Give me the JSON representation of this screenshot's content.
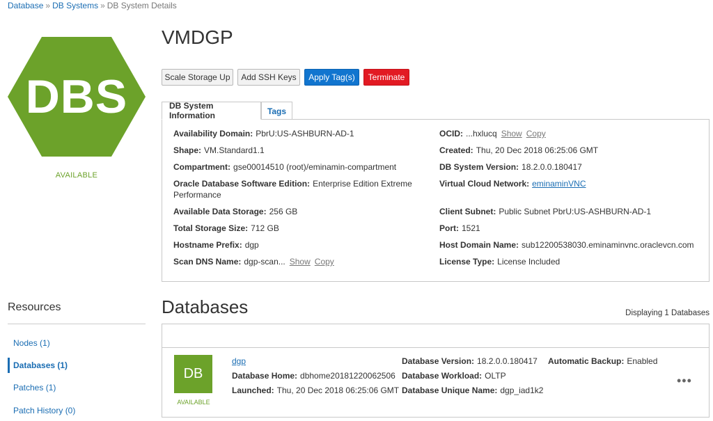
{
  "breadcrumb": {
    "items": [
      "Database",
      "DB Systems",
      "DB System Details"
    ],
    "separator": "»"
  },
  "logo": {
    "text": "DBS",
    "status": "AVAILABLE",
    "color": "#6ca22a",
    "icon": "hexagon-icon"
  },
  "title": "VMDGP",
  "actions": {
    "scale_storage": "Scale Storage Up",
    "add_ssh": "Add SSH Keys",
    "apply_tags": "Apply Tag(s)",
    "terminate": "Terminate"
  },
  "tabs": {
    "info": "DB System Information",
    "tags": "Tags"
  },
  "info": {
    "availability_domain": {
      "label": "Availability Domain:",
      "value": "PbrU:US-ASHBURN-AD-1"
    },
    "shape": {
      "label": "Shape:",
      "value": "VM.Standard1.1"
    },
    "compartment": {
      "label": "Compartment:",
      "value": "gse00014510 (root)/eminamin-compartment"
    },
    "edition": {
      "label": "Oracle Database Software Edition:",
      "value_line1": "Enterprise Edition Extreme",
      "value_line2": "Performance"
    },
    "available_storage": {
      "label": "Available Data Storage:",
      "value": "256 GB"
    },
    "total_storage": {
      "label": "Total Storage Size:",
      "value": "712 GB"
    },
    "hostname_prefix": {
      "label": "Hostname Prefix:",
      "value": "dgp"
    },
    "scan_dns": {
      "label": "Scan DNS Name:",
      "value": "dgp-scan...",
      "show": "Show",
      "copy": "Copy"
    },
    "ocid": {
      "label": "OCID:",
      "value": "...hxlucq",
      "show": "Show",
      "copy": "Copy"
    },
    "created": {
      "label": "Created:",
      "value": "Thu, 20 Dec 2018 06:25:06 GMT"
    },
    "db_version": {
      "label": "DB System Version:",
      "value": "18.2.0.0.180417"
    },
    "vcn": {
      "label": "Virtual Cloud Network:",
      "value": "eminaminVNC"
    },
    "client_subnet": {
      "label": "Client Subnet:",
      "value": "Public Subnet PbrU:US-ASHBURN-AD-1"
    },
    "port": {
      "label": "Port:",
      "value": "1521"
    },
    "host_domain": {
      "label": "Host Domain Name:",
      "value": "sub12200538030.eminaminvnc.oraclevcn.com"
    },
    "license": {
      "label": "License Type:",
      "value": "License Included"
    }
  },
  "resources": {
    "title": "Resources",
    "items": [
      {
        "label": "Nodes (1)"
      },
      {
        "label": "Databases (1)"
      },
      {
        "label": "Patches (1)"
      },
      {
        "label": "Patch History (0)"
      }
    ]
  },
  "databases": {
    "heading": "Databases",
    "displaying": "Displaying 1 Databases",
    "row": {
      "icon_text": "DB",
      "status": "AVAILABLE",
      "name": "dgp",
      "home": {
        "label": "Database Home:",
        "value": "dbhome20181220062506"
      },
      "launched": {
        "label": "Launched:",
        "value": "Thu, 20 Dec 2018 06:25:06 GMT"
      },
      "version": {
        "label": "Database Version:",
        "value": "18.2.0.0.180417"
      },
      "workload": {
        "label": "Database Workload:",
        "value": "OLTP"
      },
      "unique_name": {
        "label": "Database Unique Name:",
        "value": "dgp_iad1k2"
      },
      "backup": {
        "label": "Automatic Backup:",
        "value": "Enabled"
      },
      "menu_icon": "more-options-icon"
    }
  },
  "colors": {
    "accent": "#1175cf",
    "danger": "#e21a23",
    "status_green": "#6ca22a"
  }
}
